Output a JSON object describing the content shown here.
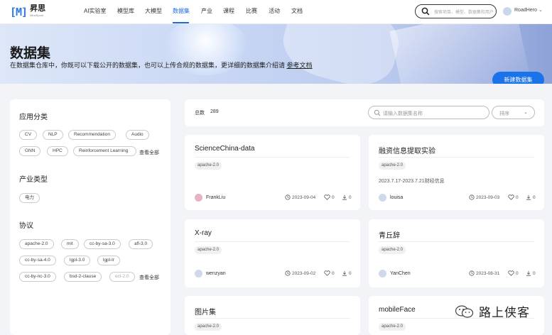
{
  "nav": {
    "logo_mark": "[M]",
    "logo_text": "昇思",
    "logo_sub": "MindSpore",
    "items": [
      {
        "label": "AI实验室"
      },
      {
        "label": "模型库"
      },
      {
        "label": "大模型"
      },
      {
        "label": "数据集"
      },
      {
        "label": "产业"
      },
      {
        "label": "课程"
      },
      {
        "label": "比赛"
      },
      {
        "label": "活动"
      },
      {
        "label": "文档"
      }
    ],
    "active_index": 3,
    "search_placeholder": "搜索项目、模型、数据集和用户",
    "user_name": "RoadHero"
  },
  "banner": {
    "title": "数据集",
    "desc": "在数据集仓库中，你既可以下载公开的数据集，也可以上传合规的数据集，更详细的数据集介绍请",
    "link": "参考文档",
    "new_button": "新建数据集"
  },
  "sidebar": {
    "app_title": "应用分类",
    "app_tags": [
      "CV",
      "NLP",
      "Recommendation",
      "Audio",
      "GNN",
      "HPC",
      "Reinforcement Learning"
    ],
    "app_view_all": "查看全部",
    "industry_title": "产业类型",
    "industry_tags": [
      "电力"
    ],
    "license_title": "协议",
    "license_tags": [
      "apache-2.0",
      "mit",
      "cc-by-sa-3.0",
      "afl-3.0",
      "cc-by-sa-4.0",
      "lgpl-3.0",
      "lgpl-lr",
      "cc-by-nc-3.0",
      "bsd-2-clause",
      "ecl-2.0"
    ],
    "license_view_all": "查看全部"
  },
  "toolbar": {
    "total_label": "总数",
    "total_count": "289",
    "search_placeholder": "请输入数据集名称",
    "sort_label": "排序"
  },
  "cards": [
    {
      "title": "ScienceChina-data",
      "license": "apache-2.0",
      "desc": "",
      "author": "FrankLiu",
      "date": "2023-09-04",
      "likes": "0",
      "downloads": "0"
    },
    {
      "title": "融资信息提取实验",
      "license": "apache-2.0",
      "desc": "2023.7.17-2023.7.21财经信息",
      "author": "louisa",
      "date": "2023-09-03",
      "likes": "0",
      "downloads": "0"
    },
    {
      "title": "X-ray",
      "license": "apache-2.0",
      "desc": "",
      "author": "wenzyan",
      "date": "2023-09-02",
      "likes": "0",
      "downloads": "0"
    },
    {
      "title": "青丘辞",
      "license": "apache-2.0",
      "desc": "",
      "author": "YanChen",
      "date": "2023-08-31",
      "likes": "0",
      "downloads": "0"
    },
    {
      "title": "图片集",
      "license": "apache-2.0",
      "desc": "",
      "author": "",
      "date": "",
      "likes": "",
      "downloads": ""
    },
    {
      "title": "mobileFace",
      "license": "apache-2.0",
      "desc": "",
      "author": "",
      "date": "",
      "likes": "",
      "downloads": ""
    }
  ],
  "watermark": "路上侠客",
  "colors": {
    "accent": "#1a73e8",
    "nav_active": "#1b6be0"
  }
}
